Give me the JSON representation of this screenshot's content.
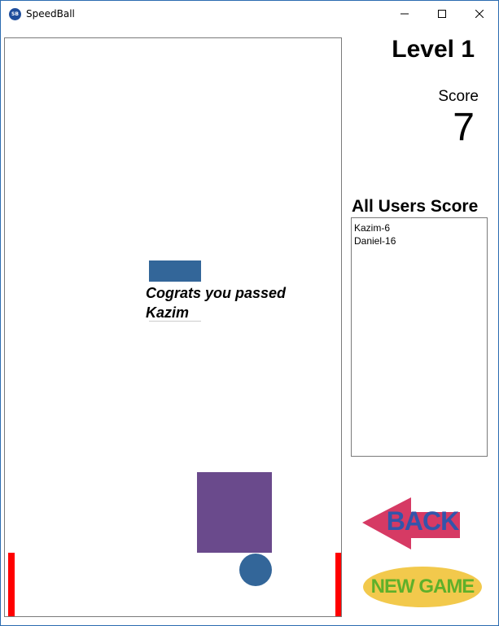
{
  "window": {
    "title": "SpeedBall",
    "icon_text": "SB"
  },
  "sidebar": {
    "level_text": "Level 1",
    "score_label": "Score",
    "score_value": "7",
    "users_title": "All Users Score",
    "users": [
      "Kazim-6",
      "Daniel-16"
    ]
  },
  "game": {
    "message_line1": "Cograts you passed",
    "message_line2": "Kazim"
  },
  "buttons": {
    "back_label": "BACK",
    "new_game_label": "NEW GAME"
  },
  "colors": {
    "wall": "#ff0000",
    "paddle": "#6a4a8c",
    "ball": "#336699",
    "back_arrow": "#d63a64",
    "back_text": "#3355aa",
    "new_game_bg": "#f2c94c",
    "new_game_text": "#5fb02a"
  }
}
